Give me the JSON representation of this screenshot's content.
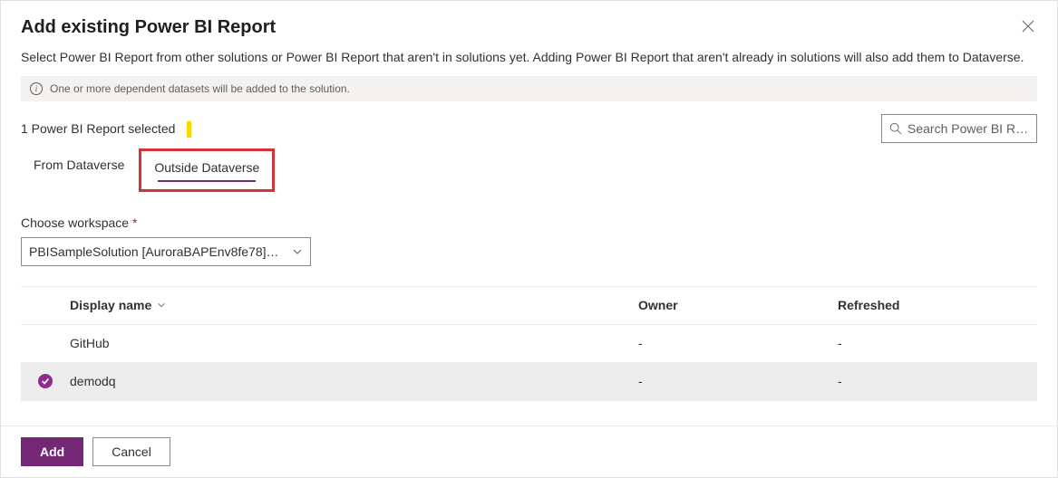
{
  "header": {
    "title": "Add existing Power BI Report"
  },
  "subtitle": "Select Power BI Report from other solutions or Power BI Report that aren't in solutions yet. Adding Power BI Report that aren't already in solutions will also add them to Dataverse.",
  "info": {
    "text": "One or more dependent datasets will be added to the solution."
  },
  "selection": {
    "text": "1 Power BI Report selected"
  },
  "search": {
    "placeholder": "Search Power BI Re..."
  },
  "tabs": {
    "from": "From Dataverse",
    "outside": "Outside Dataverse",
    "active": "outside"
  },
  "workspace": {
    "label": "Choose workspace",
    "required": "*",
    "selected": "PBISampleSolution [AuroraBAPEnv8fe78]…"
  },
  "columns": {
    "displayName": "Display name",
    "owner": "Owner",
    "refreshed": "Refreshed"
  },
  "rows": [
    {
      "selected": false,
      "displayName": "GitHub",
      "owner": "-",
      "refreshed": "-"
    },
    {
      "selected": true,
      "displayName": "demodq",
      "owner": "-",
      "refreshed": "-"
    }
  ],
  "footer": {
    "add": "Add",
    "cancel": "Cancel"
  },
  "colors": {
    "accent": "#742774",
    "highlight": "#d13438"
  }
}
